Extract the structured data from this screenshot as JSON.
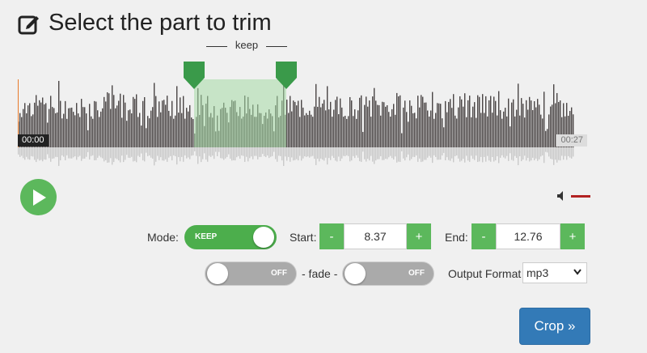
{
  "page": {
    "title": "Select the part to trim",
    "title_icon": "edit-icon"
  },
  "waveform": {
    "keep_label": "keep",
    "start_time": "00:00",
    "end_time": "00:27",
    "selection_start_fraction": 0.31,
    "selection_end_fraction": 0.47,
    "colors": {
      "wave": "#4a4545",
      "reflection": "#c9c9c9",
      "selection": "#a6daa6",
      "handle": "#3a9a4a"
    }
  },
  "player": {
    "play_icon": "play-icon",
    "volume_icon": "speaker-icon"
  },
  "controls": {
    "mode_label": "Mode:",
    "mode_value": "KEEP",
    "start_label": "Start:",
    "start_value": "8.37",
    "end_label": "End:",
    "end_value": "12.76",
    "minus": "-",
    "plus": "+",
    "fade_in_value": "OFF",
    "fade_label": "- fade -",
    "fade_out_value": "OFF",
    "output_format_label": "Output Format",
    "output_format_value": "mp3",
    "crop_label": "Crop »"
  },
  "colors": {
    "accent_green": "#5cb85c",
    "primary_blue": "#337ab7",
    "volume_red": "#b22222"
  }
}
